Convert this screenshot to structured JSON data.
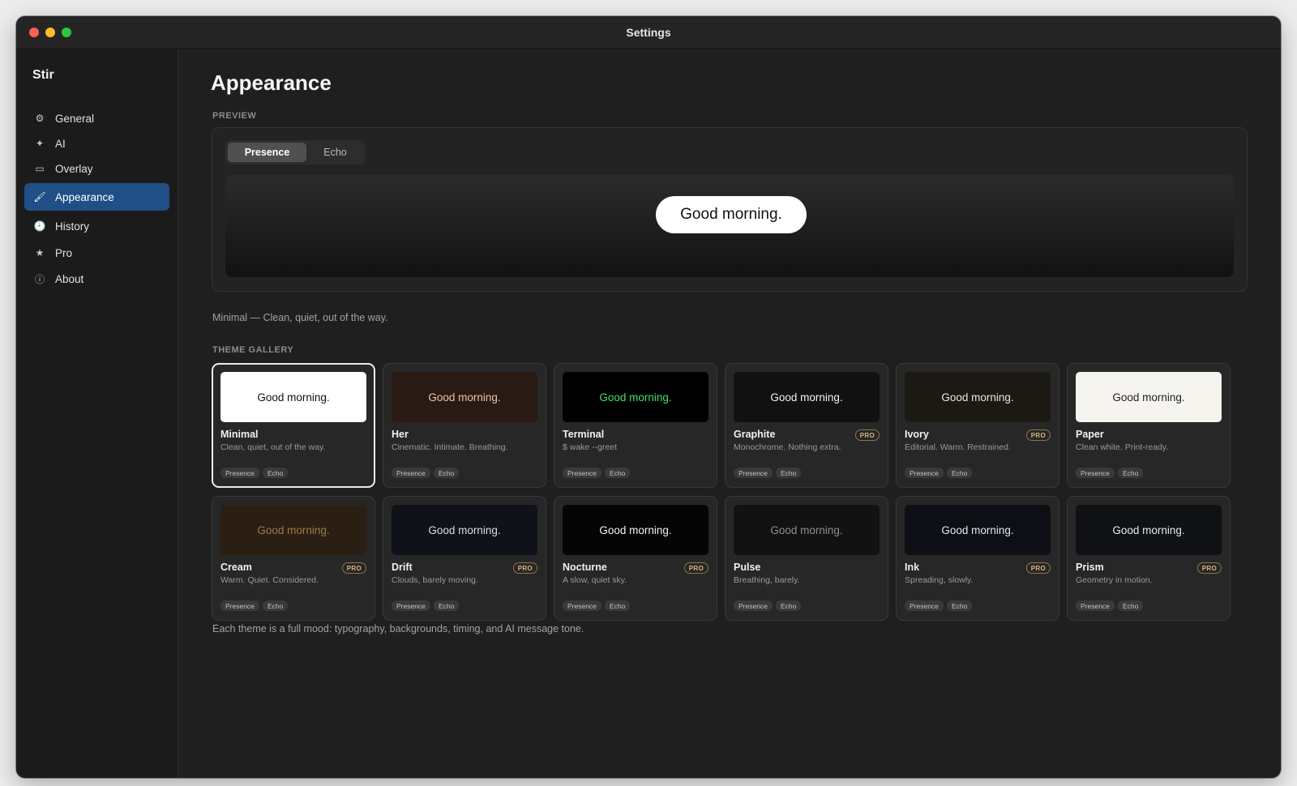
{
  "window": {
    "title": "Settings"
  },
  "sidebar": {
    "app_name": "Stir",
    "items": [
      {
        "label": "General",
        "icon": "gear-icon",
        "glyph": "⚙",
        "active": false
      },
      {
        "label": "AI",
        "icon": "sparkle-icon",
        "glyph": "✦",
        "active": false
      },
      {
        "label": "Overlay",
        "icon": "rectangle-icon",
        "glyph": "▭",
        "active": false
      },
      {
        "label": "Appearance",
        "icon": "paintbrush-icon",
        "glyph": "🖌",
        "active": true
      },
      {
        "label": "History",
        "icon": "clock-icon",
        "glyph": "🕘",
        "active": false
      },
      {
        "label": "Pro",
        "icon": "star-icon",
        "glyph": "★",
        "active": false
      },
      {
        "label": "About",
        "icon": "info-icon",
        "glyph": "ⓘ",
        "active": false
      }
    ]
  },
  "main": {
    "title": "Appearance",
    "preview": {
      "section_label": "PREVIEW",
      "tabs": [
        "Presence",
        "Echo"
      ],
      "active_tab": "Presence",
      "message": "Good morning.",
      "caption": "Minimal — Clean, quiet, out of the way."
    },
    "gallery": {
      "section_label": "THEME GALLERY",
      "caption": "Each theme is a full mood: typography, backgrounds, timing, and AI message tone.",
      "pro_label": "PRO",
      "tags": [
        "Presence",
        "Echo"
      ],
      "themes": [
        {
          "name": "Minimal",
          "desc": "Clean, quiet, out of the way.",
          "sample": "Good morning.",
          "pro": false,
          "selected": true,
          "bg": "#ffffff",
          "fg": "#111111"
        },
        {
          "name": "Her",
          "desc": "Cinematic. Intimate. Breathing.",
          "sample": "Good morning.",
          "pro": false,
          "selected": false,
          "bg": "#2a1a14",
          "fg": "#f0c2a6"
        },
        {
          "name": "Terminal",
          "desc": "$ wake --greet",
          "sample": "Good morning.",
          "pro": false,
          "selected": false,
          "bg": "#000000",
          "fg": "#3ee06e"
        },
        {
          "name": "Graphite",
          "desc": "Monochrome. Nothing extra.",
          "sample": "Good morning.",
          "pro": true,
          "selected": false,
          "bg": "#111111",
          "fg": "#f2f2f2"
        },
        {
          "name": "Ivory",
          "desc": "Editorial. Warm. Restrained.",
          "sample": "Good morning.",
          "pro": true,
          "selected": false,
          "bg": "#1c1814",
          "fg": "#f0e6d6"
        },
        {
          "name": "Paper",
          "desc": "Clean white. Print-ready.",
          "sample": "Good morning.",
          "pro": false,
          "selected": false,
          "bg": "#f6f4ef",
          "fg": "#222222"
        },
        {
          "name": "Cream",
          "desc": "Warm. Quiet. Considered.",
          "sample": "Good morning.",
          "pro": true,
          "selected": false,
          "bg": "#2a1f12",
          "fg": "#9d7a4c"
        },
        {
          "name": "Drift",
          "desc": "Clouds, barely moving.",
          "sample": "Good morning.",
          "pro": true,
          "selected": false,
          "bg": "#10121a",
          "fg": "#d8dce6"
        },
        {
          "name": "Nocturne",
          "desc": "A slow, quiet sky.",
          "sample": "Good morning.",
          "pro": true,
          "selected": false,
          "bg": "#050505",
          "fg": "#f2f2f2"
        },
        {
          "name": "Pulse",
          "desc": "Breathing, barely.",
          "sample": "Good morning.",
          "pro": false,
          "selected": false,
          "bg": "#121212",
          "fg": "#8e8e8e"
        },
        {
          "name": "Ink",
          "desc": "Spreading, slowly.",
          "sample": "Good morning.",
          "pro": true,
          "selected": false,
          "bg": "#0e0f14",
          "fg": "#e6e8ee"
        },
        {
          "name": "Prism",
          "desc": "Geometry in motion.",
          "sample": "Good morning.",
          "pro": true,
          "selected": false,
          "bg": "#0f1114",
          "fg": "#e8eaee"
        }
      ]
    }
  },
  "colors": {
    "accent": "#1f4f86",
    "window_bg": "#1f1f1f",
    "pro_badge": "#d5b87d"
  }
}
